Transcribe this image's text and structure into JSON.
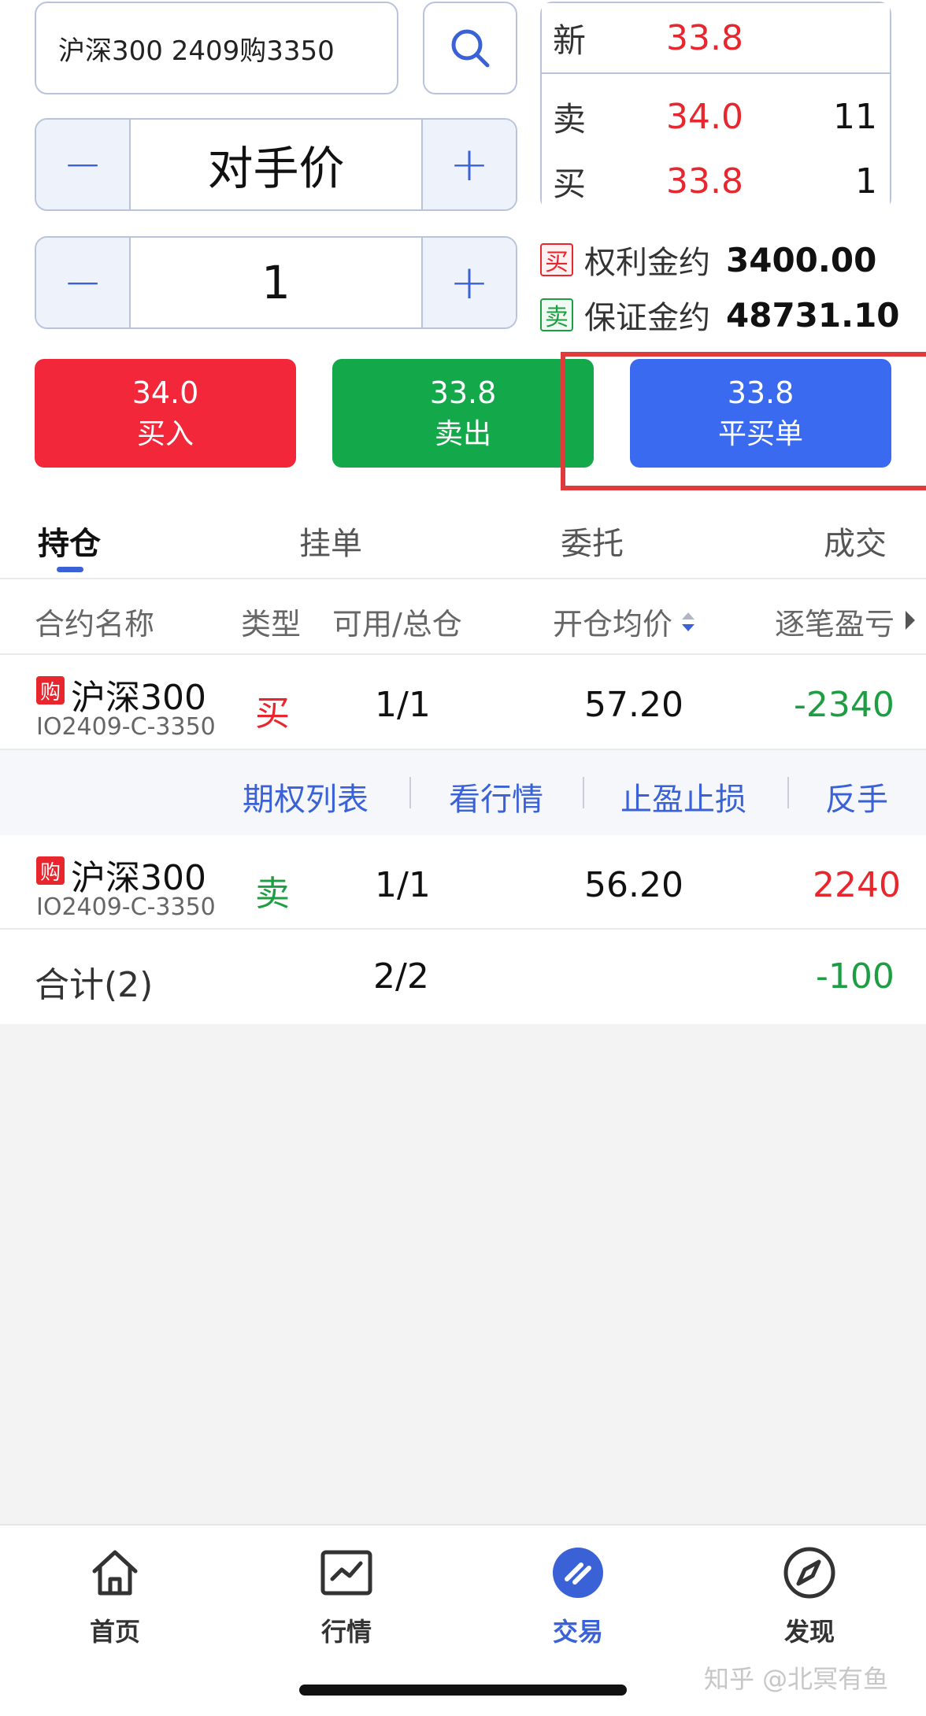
{
  "search": {
    "value": "沪深300 2409购3350"
  },
  "price_stepper": {
    "minus": "−",
    "value": "对手价",
    "plus": "+"
  },
  "qty_stepper": {
    "minus": "−",
    "value": "1",
    "plus": "+"
  },
  "quote": {
    "latest": {
      "label": "新",
      "price": "33.8"
    },
    "ask": {
      "label": "卖",
      "price": "34.0",
      "qty": "11"
    },
    "bid": {
      "label": "买",
      "price": "33.8",
      "qty": "1"
    }
  },
  "info": [
    {
      "tag": "买",
      "label": "权利金约",
      "value": "3400.00"
    },
    {
      "tag": "卖",
      "label": "保证金约",
      "value": "48731.10"
    }
  ],
  "actions": [
    {
      "price": "34.0",
      "label": "买入",
      "color": "#f2283a"
    },
    {
      "price": "33.8",
      "label": "卖出",
      "color": "#13a84a"
    },
    {
      "price": "33.8",
      "label": "平买单",
      "color": "#3a6af0"
    }
  ],
  "tabs": [
    "持仓",
    "挂单",
    "委托",
    "成交"
  ],
  "table": {
    "headers": [
      "合约名称",
      "类型",
      "可用/总仓",
      "开仓均价",
      "逐笔盈亏"
    ],
    "rows": [
      {
        "badge": "购",
        "name": "沪深300",
        "code": "IO2409-C-3350",
        "type": "买",
        "avail": "1/1",
        "avg_price": "57.20",
        "pnl": "-2340"
      },
      {
        "badge": "购",
        "name": "沪深300",
        "code": "IO2409-C-3350",
        "type": "卖",
        "avail": "1/1",
        "avg_price": "56.20",
        "pnl": "2240"
      }
    ],
    "total": {
      "label": "合计(2)",
      "avail": "2/2",
      "pnl": "-100"
    }
  },
  "row_actions": [
    "期权列表",
    "看行情",
    "止盈止损",
    "反手"
  ],
  "colors": {
    "accent": "#3a62d6",
    "up": "#e8262e",
    "down": "#1e9e43"
  },
  "nav": [
    {
      "label": "首页",
      "icon": "home-icon"
    },
    {
      "label": "行情",
      "icon": "chart-icon"
    },
    {
      "label": "交易",
      "icon": "trade-icon"
    },
    {
      "label": "发现",
      "icon": "compass-icon"
    }
  ],
  "watermark": "知乎 @北冥有鱼"
}
